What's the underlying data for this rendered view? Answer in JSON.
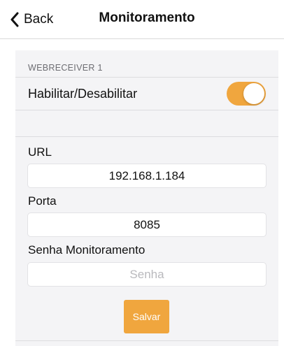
{
  "navbar": {
    "back_label": "Back",
    "back_icon": "chevron-left-icon",
    "title": "Monitoramento"
  },
  "section": {
    "header": "WEBRECEIVER 1",
    "toggle": {
      "label": "Habilitar/Desabilitar",
      "enabled": true
    }
  },
  "form": {
    "url": {
      "label": "URL",
      "value": "192.168.1.184"
    },
    "port": {
      "label": "Porta",
      "value": "8085"
    },
    "password": {
      "label": "Senha Monitoramento",
      "value": "",
      "placeholder": "Senha"
    },
    "save_label": "Salvar"
  },
  "colors": {
    "accent": "#f0a63e",
    "panel_background": "#f4f4f6",
    "section_header": "#6d6d72"
  }
}
